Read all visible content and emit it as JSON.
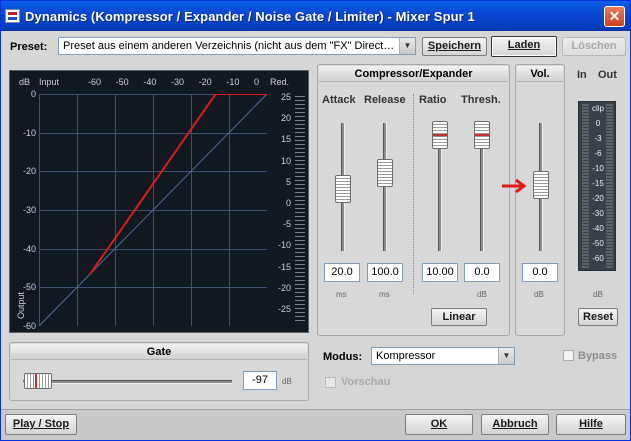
{
  "window": {
    "title": "Dynamics (Kompressor / Expander / Noise Gate / Limiter) - Mixer Spur 1",
    "close_glyph": "✕"
  },
  "preset": {
    "label": "Preset:",
    "value": "Preset aus einem anderen Verzeichnis  (nicht aus dem \"FX\" Direct…",
    "save_label": "Speichern",
    "load_label": "Laden",
    "delete_label": "Löschen"
  },
  "graph": {
    "db_label": "dB",
    "input_label": "Input",
    "output_label": "Output",
    "red_label": "Red.",
    "input_ticks": [
      "-60",
      "-50",
      "-40",
      "-30",
      "-20",
      "-10",
      "0"
    ],
    "output_ticks": [
      "0",
      "-10",
      "-20",
      "-30",
      "-40",
      "-50",
      "-60"
    ],
    "reduction_ticks": [
      "25",
      "20",
      "15",
      "10",
      "5",
      "0",
      "-5",
      "-10",
      "-15",
      "-20",
      "-25"
    ],
    "curve_color": "#e01a1a"
  },
  "compressor": {
    "header": "Compressor/Expander",
    "attack": {
      "label": "Attack",
      "value": "20.0",
      "unit": "ms"
    },
    "release": {
      "label": "Release",
      "value": "100.0",
      "unit": "ms"
    },
    "ratio": {
      "label": "Ratio",
      "value": "10.00"
    },
    "threshold": {
      "label": "Thresh.",
      "value": "0.0",
      "unit": "dB"
    },
    "linear_label": "Linear"
  },
  "volume": {
    "header": "Vol.",
    "value": "0.0",
    "unit": "dB"
  },
  "meter": {
    "in_label": "In",
    "out_label": "Out",
    "ticks": [
      "clip",
      "0",
      "-3",
      "-6",
      "-10",
      "-15",
      "-20",
      "-30",
      "-40",
      "-50",
      "-60"
    ],
    "unit": "dB",
    "reset_label": "Reset"
  },
  "gate": {
    "header": "Gate",
    "value": "-97",
    "unit": "dB"
  },
  "modus": {
    "label": "Modus:",
    "value": "Kompressor"
  },
  "bypass_label": "Bypass",
  "preview_label": "Vorschau",
  "footer": {
    "play_stop_label": "Play / Stop",
    "ok_label": "OK",
    "cancel_label": "Abbruch",
    "help_label": "Hilfe"
  },
  "accent_arrow_color": "#e01a1a"
}
